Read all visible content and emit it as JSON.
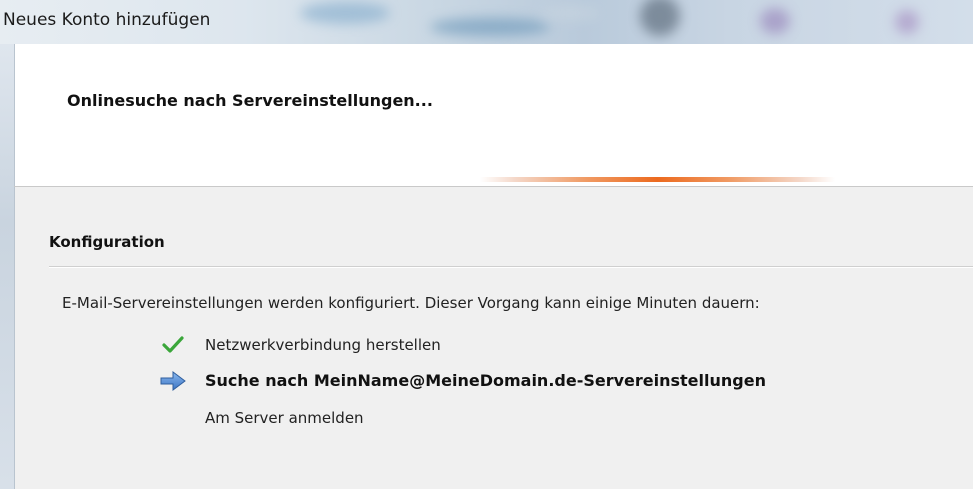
{
  "window": {
    "title": "Neues Konto hinzufügen"
  },
  "header": {
    "title": "Onlinesuche nach Servereinstellungen...",
    "progress": "indeterminate"
  },
  "section": {
    "title": "Konfiguration",
    "description": "E-Mail-Servereinstellungen werden konfiguriert. Dieser Vorgang kann einige Minuten dauern:"
  },
  "steps": [
    {
      "label": "Netzwerkverbindung herstellen",
      "status": "done",
      "icon": "check-icon"
    },
    {
      "label": "Suche nach MeinName@MeineDomain.de-Servereinstellungen",
      "status": "active",
      "icon": "arrow-right-icon"
    },
    {
      "label": "Am Server anmelden",
      "status": "pending",
      "icon": ""
    }
  ],
  "colors": {
    "check": "#3aa63a",
    "arrow": "#4a86d4",
    "progress": "#ec6a1f"
  }
}
